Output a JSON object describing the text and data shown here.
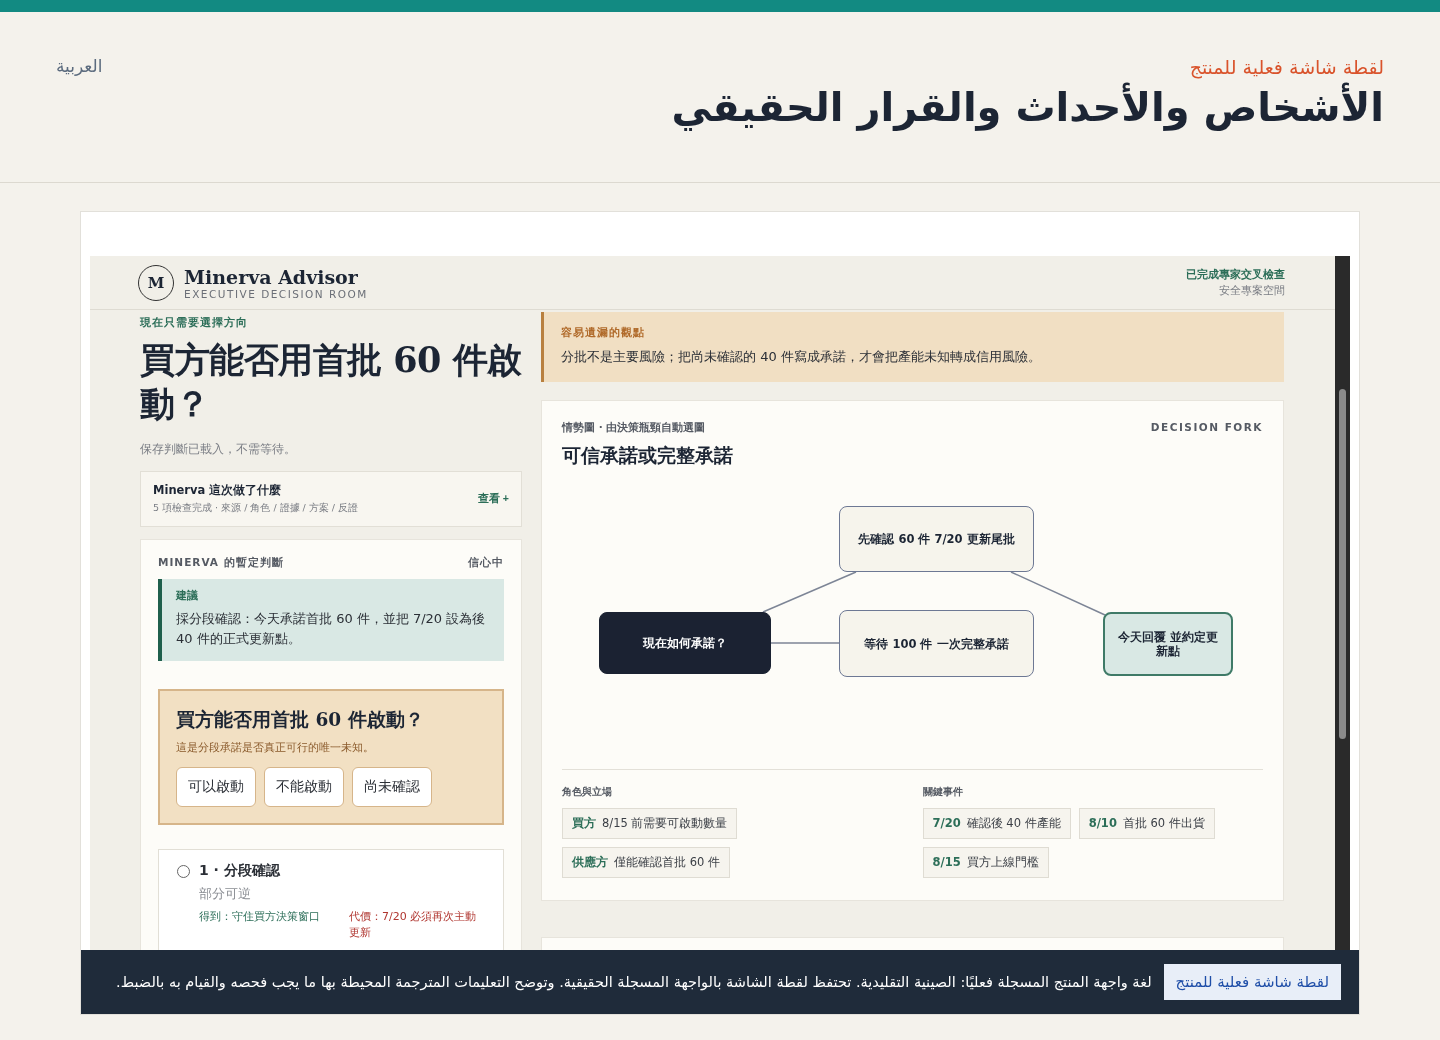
{
  "page": {
    "language_link": "العربية",
    "eyebrow": "لقطة شاشة فعلية للمنتج",
    "title": "الأشخاص والأحداث والقرار الحقيقي"
  },
  "app": {
    "brand": {
      "logo": "M",
      "name": "Minerva Advisor",
      "subtitle": "EXECUTIVE DECISION ROOM"
    },
    "status": {
      "verified": "已完成專家交叉檢查",
      "space": "安全專案空間"
    }
  },
  "left": {
    "kicker": "現在只需要選擇方向",
    "question": "買方能否用首批 60 件啟動？",
    "note": "保存判斷已載入，不需等待。",
    "activity": {
      "title": "Minerva 這次做了什麼",
      "summary": "5 項檢查完成 · 來源 / 角色 / 證據 / 方案 / 反證",
      "action": "查看 +"
    },
    "verdict": {
      "label": "MINERVA 的暫定判斷",
      "confidence": "信心中",
      "recommendation": {
        "label": "建議",
        "text": "採分段確認：今天承諾首批 60 件，並把 7/20 設為後 40 件的正式更新點。"
      },
      "unknown": {
        "title": "買方能否用首批 60 件啟動？",
        "desc": "這是分段承諾是否真正可行的唯一未知。",
        "answers": [
          "可以啟動",
          "不能啟動",
          "尚未確認"
        ]
      }
    },
    "options": [
      {
        "title": "1 · 分段確認",
        "selected": false,
        "reversibility": "部分可逆",
        "gain": "得到：守住買方決策窗口",
        "cost": "代價：7/20 必須再次主動更新"
      }
    ]
  },
  "right": {
    "insight": {
      "label": "容易遺漏的觀點",
      "text": "分批不是主要風險；把尚未確認的 40 件寫成承諾，才會把產能未知轉成信用風險。"
    },
    "map": {
      "kicker": "情勢圖 · 由決策瓶頸自動選圖",
      "tag": "DECISION FORK",
      "title": "可信承諾或完整承諾",
      "nodes": [
        {
          "label": "先確認 60 件 7/20 更新尾批",
          "kind": "option"
        },
        {
          "label": "現在如何承諾？",
          "kind": "root"
        },
        {
          "label": "等待 100 件 一次完整承諾",
          "kind": "option"
        },
        {
          "label": "今天回覆 並約定更新點",
          "kind": "chosen"
        }
      ],
      "roles_label": "角色與立場",
      "roles": [
        {
          "who": "買方",
          "text": "8/15 前需要可啟動數量"
        },
        {
          "who": "供應方",
          "text": "僅能確認首批 60 件"
        }
      ],
      "events_label": "關鍵事件",
      "events": [
        {
          "date": "7/20",
          "text": "確認後 40 件產能"
        },
        {
          "date": "8/10",
          "text": "首批 60 件出貨"
        },
        {
          "date": "8/15",
          "text": "買方上線門檻"
        }
      ]
    }
  },
  "caption": {
    "badge": "لقطة شاشة فعلية للمنتج",
    "text": "لغة واجهة المنتج المسجلة فعليًا: الصينية التقليدية. تحتفظ لقطة الشاشة بالواجهة المسجلة الحقيقية. وتوضح التعليمات المترجمة المحيطة بها ما يجب فحصه والقيام به بالضبط."
  }
}
